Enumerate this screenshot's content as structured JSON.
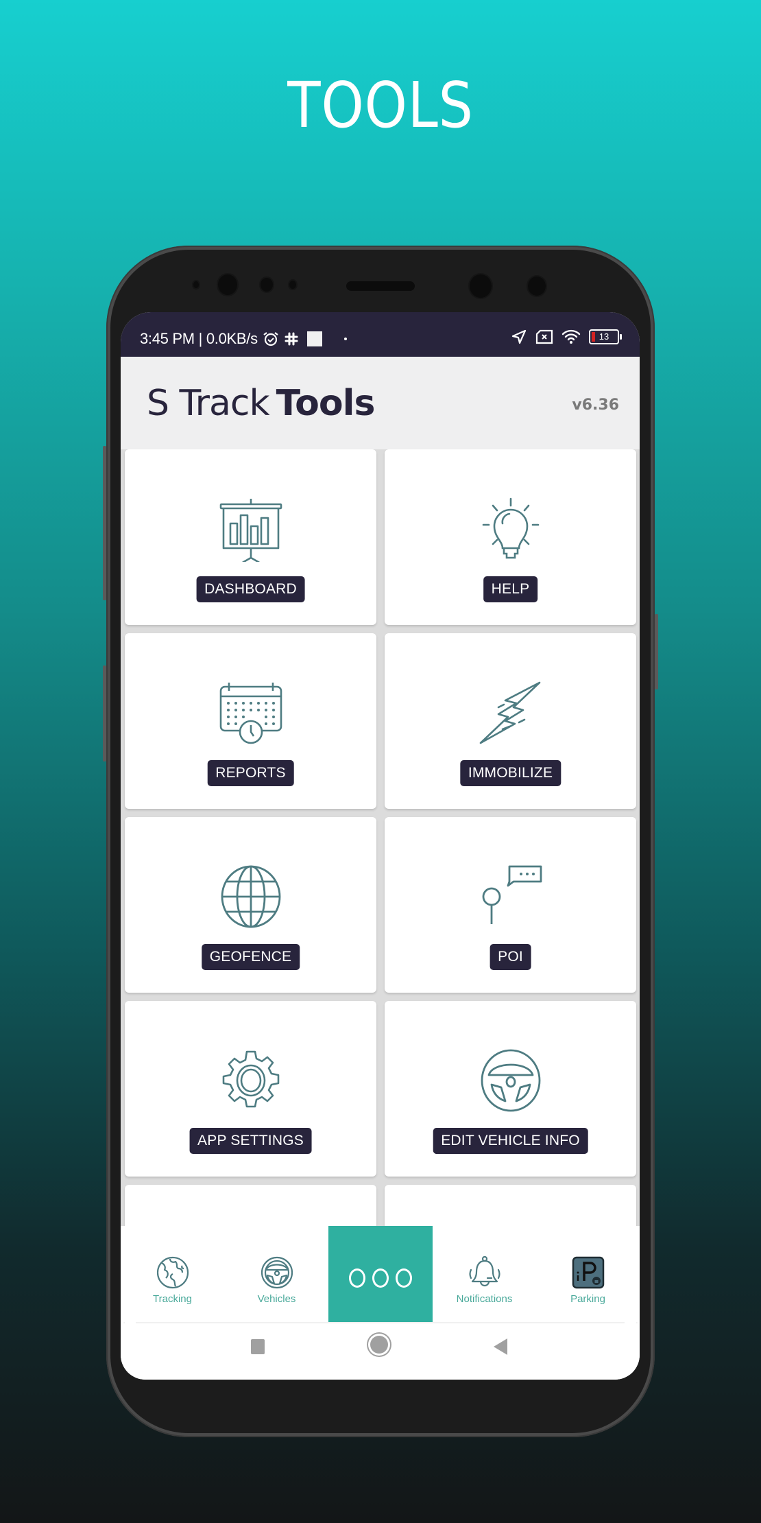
{
  "promo": {
    "title": "TOOLS"
  },
  "statusbar": {
    "time_network": "3:45 PM | 0.0KB/s",
    "battery_level": "13",
    "icons": [
      "alarm-icon",
      "slack-icon",
      "image-icon",
      "dot-icon",
      "location-arrow-icon",
      "sim-x-icon",
      "wifi-icon",
      "battery-icon"
    ]
  },
  "header": {
    "title_light": "S Track",
    "title_bold": "Tools",
    "version": "v6.36"
  },
  "tiles": [
    {
      "label": "DASHBOARD",
      "icon": "presentation-chart-icon"
    },
    {
      "label": "HELP",
      "icon": "lightbulb-icon"
    },
    {
      "label": "REPORTS",
      "icon": "calendar-clock-icon"
    },
    {
      "label": "IMMOBILIZE",
      "icon": "lightning-bolt-icon"
    },
    {
      "label": "GEOFENCE",
      "icon": "globe-icon"
    },
    {
      "label": "POI",
      "icon": "pin-chat-icon"
    },
    {
      "label": "APP SETTINGS",
      "icon": "gear-icon"
    },
    {
      "label": "EDIT VEHICLE INFO",
      "icon": "steering-wheel-icon"
    }
  ],
  "bottom_nav": {
    "items": [
      {
        "label": "Tracking",
        "icon": "earth-icon"
      },
      {
        "label": "Vehicles",
        "icon": "steering-wheel-icon"
      },
      {
        "label": "",
        "icon": "more-dots-icon",
        "active": true
      },
      {
        "label": "Notifications",
        "icon": "bell-icon"
      },
      {
        "label": "Parking",
        "icon": "parking-icon"
      }
    ]
  },
  "colors": {
    "accent": "#2fb0a0",
    "icon_stroke": "#4e7c82",
    "label_bg": "#28243c",
    "statusbar_bg": "#28243c",
    "nav_label": "#49a99a"
  }
}
